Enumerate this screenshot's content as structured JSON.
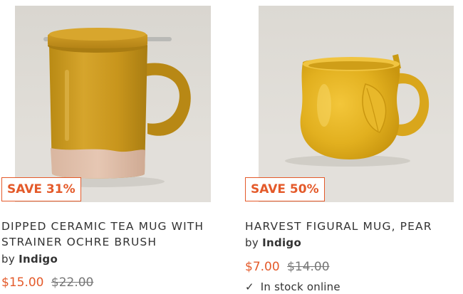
{
  "products": [
    {
      "badge": "SAVE 31%",
      "title": "DIPPED CERAMIC TEA MUG WITH STRAINER OCHRE BRUSH",
      "by_prefix": "by",
      "brand": "Indigo",
      "sale_price": "$15.00",
      "original_price": "$22.00",
      "image_icon": "ochre-tea-mug-with-strainer-image"
    },
    {
      "badge": "SAVE 50%",
      "title": "HARVEST FIGURAL MUG, PEAR",
      "by_prefix": "by",
      "brand": "Indigo",
      "sale_price": "$7.00",
      "original_price": "$14.00",
      "stock_icon": "checkmark-icon",
      "stock_text": "In stock online",
      "image_icon": "pear-mug-image"
    }
  ],
  "colors": {
    "sale_accent": "#e45a2a",
    "text": "#333333",
    "strikethrough": "#777777"
  }
}
